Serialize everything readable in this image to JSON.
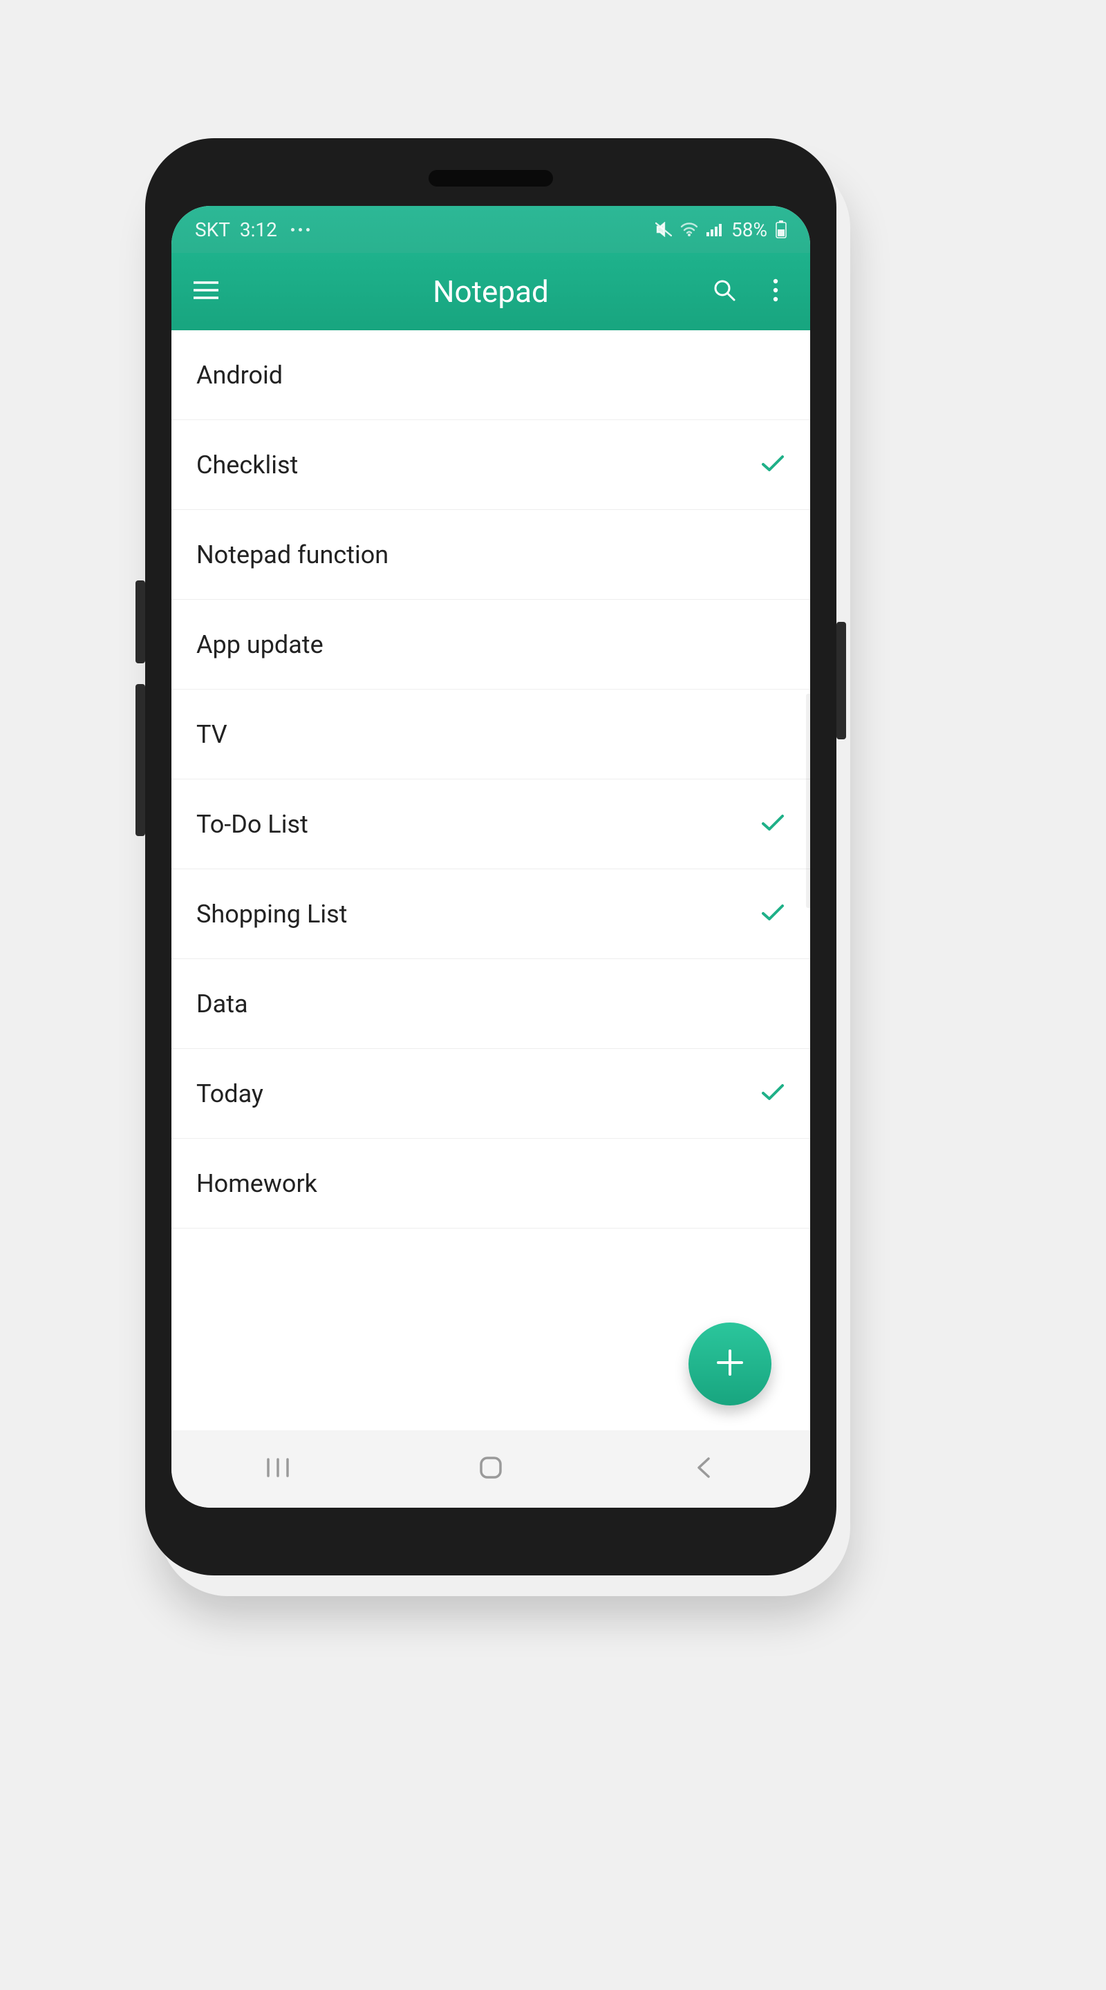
{
  "statusbar": {
    "carrier": "SKT",
    "time": "3:12",
    "battery_pct": "58%"
  },
  "appbar": {
    "title": "Notepad"
  },
  "notes": [
    {
      "title": "Android",
      "checked": false
    },
    {
      "title": "Checklist",
      "checked": true
    },
    {
      "title": "Notepad function",
      "checked": false
    },
    {
      "title": "App update",
      "checked": false
    },
    {
      "title": "TV",
      "checked": false
    },
    {
      "title": "To-Do List",
      "checked": true
    },
    {
      "title": "Shopping List",
      "checked": true
    },
    {
      "title": "Data",
      "checked": false
    },
    {
      "title": "Today",
      "checked": true
    },
    {
      "title": "Homework",
      "checked": false
    }
  ],
  "colors": {
    "accent": "#1fb088"
  }
}
